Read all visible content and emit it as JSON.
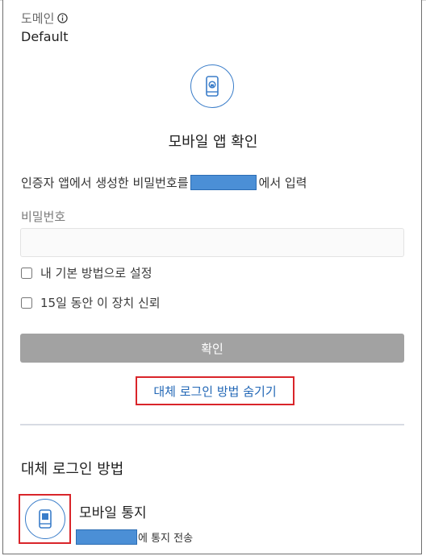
{
  "domain": {
    "label": "도메인",
    "value": "Default"
  },
  "header": {
    "title": "모바일 앱 확인"
  },
  "instruction": {
    "before": "인증자 앱에서 생성한 비밀번호를",
    "after": "에서 입력"
  },
  "password": {
    "label": "비밀번호",
    "value": "",
    "placeholder": ""
  },
  "options": {
    "default_method": {
      "label": "내 기본 방법으로 설정",
      "checked": false
    },
    "trust_device": {
      "label": "15일 동안 이 장치 신뢰",
      "checked": false
    }
  },
  "buttons": {
    "confirm": "확인"
  },
  "links": {
    "hide_alternatives": "대체 로그인 방법 숨기기"
  },
  "alternatives": {
    "heading": "대체 로그인 방법",
    "items": [
      {
        "title": "모바일 통지",
        "description": "에 통지 전송"
      }
    ]
  },
  "colors": {
    "accent": "#3a7dc9",
    "link": "#2267b6",
    "highlight": "#d9252a",
    "redaction": "#4b8fd6",
    "button_disabled": "#a2a2a2"
  },
  "icons": {
    "info": "info-icon",
    "app": "mobile-app-icon",
    "notification": "mobile-notification-icon"
  }
}
